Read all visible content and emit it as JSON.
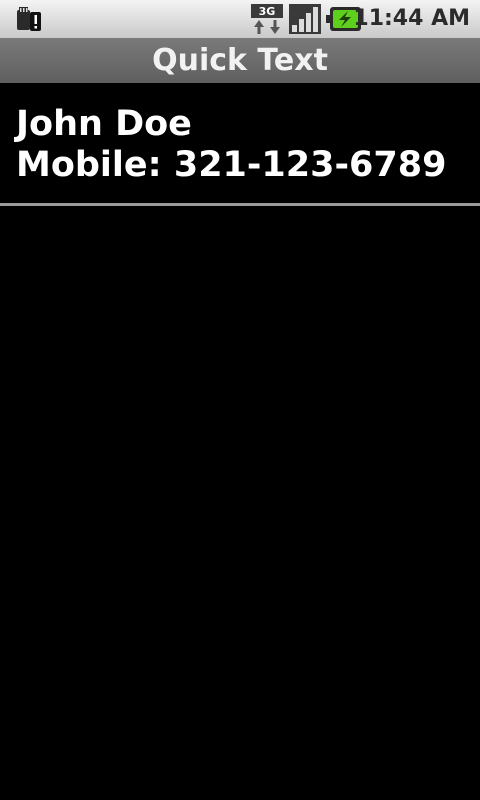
{
  "status_bar": {
    "time": "11:44 AM",
    "network_label": "3G",
    "icons": [
      "sd-card-warning-icon",
      "network-3g-icon",
      "signal-strength-icon",
      "battery-charging-icon"
    ]
  },
  "title_bar": {
    "title": "Quick Text"
  },
  "contact": {
    "name": "John Doe",
    "phone": "Mobile: 321-123-6789"
  },
  "colors": {
    "background": "#000000",
    "title_bar": "#6b6b6b",
    "status_bar": "#dcdcdc",
    "text": "#ffffff",
    "battery_accent": "#5fcf1e"
  }
}
